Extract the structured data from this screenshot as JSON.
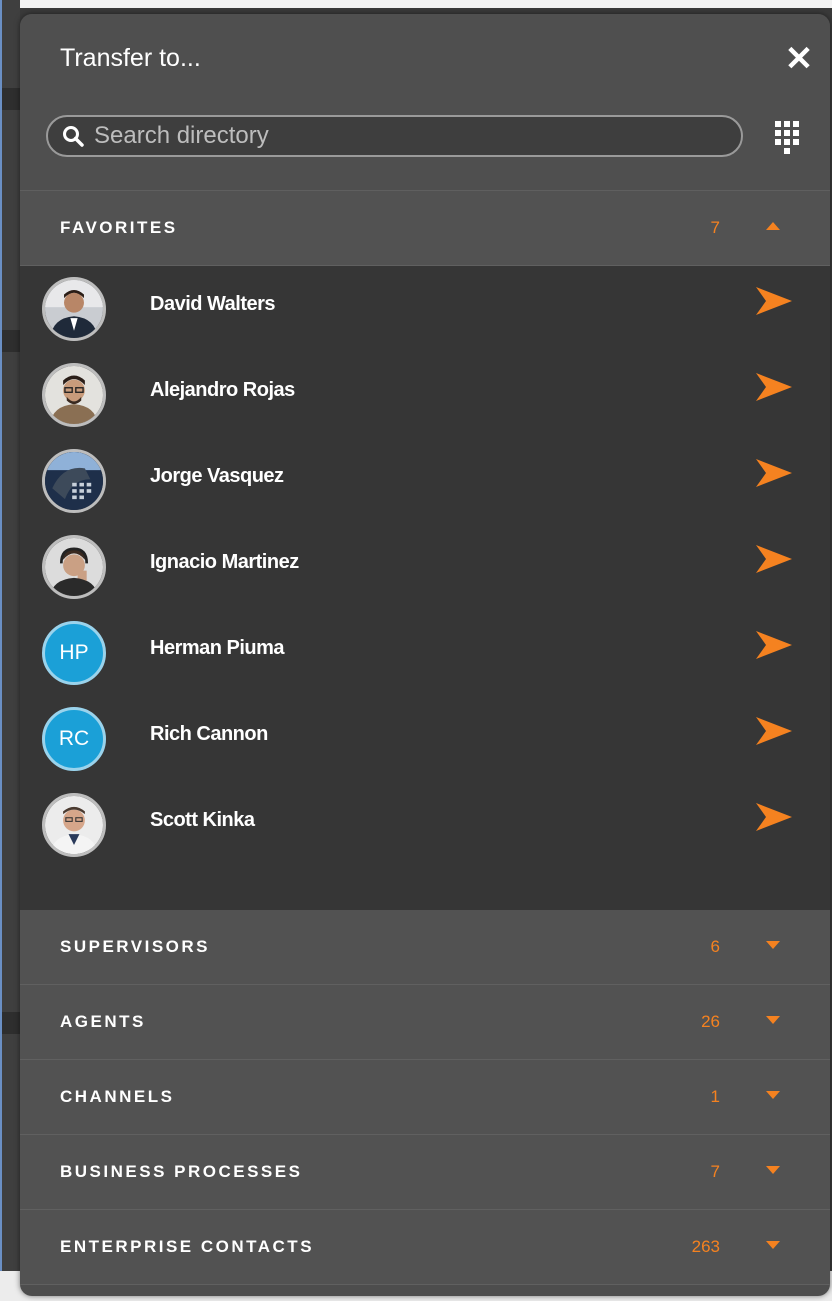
{
  "dialog": {
    "title": "Transfer to...",
    "close_icon": "close-icon",
    "search_placeholder": "Search directory",
    "dialpad_icon": "dialpad-icon"
  },
  "colors": {
    "accent": "#f58220",
    "initials_avatar": "#1ba0d7",
    "panel": "#4d4d4d",
    "list_bg": "#363636"
  },
  "favorites": {
    "label": "FAVORITES",
    "count": "7",
    "expanded": true,
    "contacts": [
      {
        "name": "David Walters",
        "avatar": "photo"
      },
      {
        "name": "Alejandro Rojas",
        "avatar": "photo"
      },
      {
        "name": "Jorge Vasquez",
        "avatar": "photo"
      },
      {
        "name": "Ignacio Martinez",
        "avatar": "photo"
      },
      {
        "name": "Herman Piuma",
        "avatar": "initials",
        "initials": "HP"
      },
      {
        "name": "Rich Cannon",
        "avatar": "initials",
        "initials": "RC"
      },
      {
        "name": "Scott Kinka",
        "avatar": "photo"
      }
    ]
  },
  "sections": [
    {
      "label": "SUPERVISORS",
      "count": "6"
    },
    {
      "label": "AGENTS",
      "count": "26"
    },
    {
      "label": "CHANNELS",
      "count": "1"
    },
    {
      "label": "BUSINESS PROCESSES",
      "count": "7"
    },
    {
      "label": "ENTERPRISE CONTACTS",
      "count": "263"
    }
  ]
}
